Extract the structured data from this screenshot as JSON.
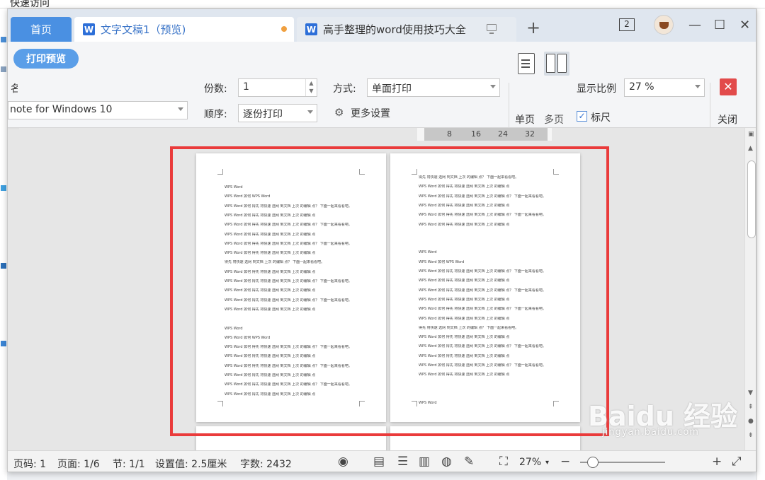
{
  "desktop": {
    "title": "快速访问"
  },
  "tabs": {
    "home": "首页",
    "active": "文字文稿1（预览)",
    "other": "高手整理的word使用技巧大全",
    "badge": "2"
  },
  "toolbar": {
    "print_preview": "打印预览",
    "printer_label": "名",
    "printer_value": "note for Windows 10",
    "copies_label": "份数:",
    "copies_value": "1",
    "order_label": "顺序:",
    "order_value": "逐份打印",
    "mode_label": "方式:",
    "mode_value": "单面打印",
    "more_settings": "更多设置",
    "single_page": "单页",
    "multi_page": "多页",
    "zoom_label": "显示比例",
    "zoom_value": "27 %",
    "ruler_label": "标尺",
    "close_label": "关闭"
  },
  "ruler": {
    "ticks": [
      "8",
      "16",
      "24",
      "32"
    ]
  },
  "pages": {
    "left": [
      "WPS Word",
      "WPS Word 如何 WPS Word",
      "WPS Word 如何 得先 将快速 选网 到文档 上次 的编辑 点？ 下面一起来看看吧。",
      "WPS Word 如何 得先 将快速 选网 到文档 上次 的编辑 点",
      "WPS Word 如何 得先 将快速 选网 到文档 上次 的编辑 点？ 下面一起来看看吧。",
      "WPS Word 如何 得先 将快速 选网 到文档 上次 的编辑 点",
      "WPS Word 如何 得先 将快速 选网 到文档 上次 的编辑 点？ 下面一起来看看吧。",
      "WPS Word 如何 得先 将快速 选网 到文档 上次 的编辑 点",
      "得先 将快速 选网 到文档 上次 的编辑 点？ 下面一起来看看吧。",
      "WPS Word 如何 得先 将快速 选网 到文档 上次 的编辑 点",
      "WPS Word 如何 得先 将快速 选网 到文档 上次 的编辑 点？ 下面一起来看看吧。",
      "WPS Word 如何 得先 将快速 选网 到文档 上次 的编辑 点",
      "WPS Word 如何 得先 将快速 选网 到文档 上次 的编辑 点？ 下面一起来看看吧。",
      "WPS Word 如何 得先 将快速 选网 到文档 上次 的编辑 点",
      "",
      "WPS Word",
      "WPS Word 如何 WPS Word",
      "WPS Word 如何 得先 将快速 选网 到文档 上次 的编辑 点？ 下面一起来看看吧。",
      "WPS Word 如何 得先 将快速 选网 到文档 上次 的编辑 点",
      "WPS Word 如何 得先 将快速 选网 到文档 上次 的编辑 点？ 下面一起来看看吧。",
      "WPS Word 如何 得先 将快速 选网 到文档 上次 的编辑 点",
      "WPS Word 如何 得先 将快速 选网 到文档 上次 的编辑 点？ 下面一起来看看吧。",
      "WPS Word 如何 得先 将快速 选网 到文档 上次 的编辑 点"
    ],
    "right": [
      "得先 将快速 选网 到文档 上次 的编辑 点？ 下面一起来看看吧。",
      "WPS Word 如何 得先 将快速 选网 到文档 上次 的编辑 点",
      "WPS Word 如何 得先 将快速 选网 到文档 上次 的编辑 点？ 下面一起来看看吧。",
      "WPS Word 如何 得先 将快速 选网 到文档 上次 的编辑 点",
      "WPS Word 如何 得先 将快速 选网 到文档 上次 的编辑 点？ 下面一起来看看吧。",
      "WPS Word 如何 得先 将快速 选网 到文档 上次 的编辑 点",
      "",
      "",
      "WPS Word",
      "WPS Word 如何 WPS Word",
      "WPS Word 如何 得先 将快速 选网 到文档 上次 的编辑 点？ 下面一起来看看吧。",
      "WPS Word 如何 得先 将快速 选网 到文档 上次 的编辑 点",
      "WPS Word 如何 得先 将快速 选网 到文档 上次 的编辑 点？ 下面一起来看看吧。",
      "WPS Word 如何 得先 将快速 选网 到文档 上次 的编辑 点",
      "WPS Word 如何 得先 将快速 选网 到文档 上次 的编辑 点？ 下面一起来看看吧。",
      "WPS Word 如何 得先 将快速 选网 到文档 上次 的编辑 点",
      "得先 将快速 选网 到文档 上次 的编辑 点？ 下面一起来看看吧。",
      "WPS Word 如何 得先 将快速 选网 到文档 上次 的编辑 点",
      "WPS Word 如何 得先 将快速 选网 到文档 上次 的编辑 点？ 下面一起来看看吧。",
      "WPS Word 如何 得先 将快速 选网 到文档 上次 的编辑 点",
      "WPS Word 如何 得先 将快速 选网 到文档 上次 的编辑 点？ 下面一起来看看吧。",
      "WPS Word 如何 得先 将快速 选网 到文档 上次 的编辑 点",
      "",
      "",
      "WPS Word"
    ]
  },
  "status": {
    "page_no": "页码: 1",
    "pages": "页面: 1/6",
    "section": "节: 1/1",
    "setting": "设置值: 2.5厘米",
    "words": "字数: 2432",
    "zoom": "27%"
  },
  "watermark": {
    "brand": "Baidu 经验",
    "url": "jingyan.baidu.com"
  },
  "colors": {
    "accent": "#4a90e2",
    "highlight_box": "#ea3b3b",
    "close": "#e24b4b"
  }
}
